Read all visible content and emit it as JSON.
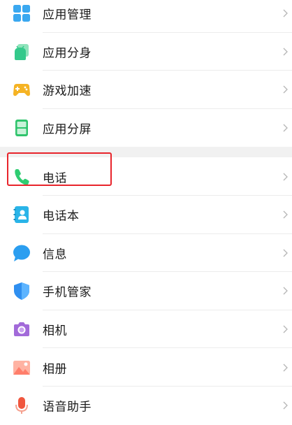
{
  "settings_group_1": {
    "items": [
      {
        "label": "应用管理",
        "icon": "app-management-icon",
        "color": "#3aa8f0"
      },
      {
        "label": "应用分身",
        "icon": "app-clone-icon",
        "color": "#34c98b"
      },
      {
        "label": "游戏加速",
        "icon": "game-acceleration-icon",
        "color": "#f5b324"
      },
      {
        "label": "应用分屏",
        "icon": "split-screen-icon",
        "color": "#2fc46c"
      }
    ]
  },
  "settings_group_2": {
    "items": [
      {
        "label": "电话",
        "icon": "phone-icon",
        "color": "#2ecc71"
      },
      {
        "label": "电话本",
        "icon": "contacts-icon",
        "color": "#2ab4e8"
      },
      {
        "label": "信息",
        "icon": "messages-icon",
        "color": "#2b9ef0"
      },
      {
        "label": "手机管家",
        "icon": "phone-manager-icon",
        "color": "#2f8ff0"
      },
      {
        "label": "相机",
        "icon": "camera-icon",
        "color": "#a26ad9"
      },
      {
        "label": "相册",
        "icon": "gallery-icon",
        "color": "#ff7e6b"
      },
      {
        "label": "语音助手",
        "icon": "voice-assistant-icon",
        "color": "#f0563e"
      }
    ]
  },
  "chevron_icon": "chevron-right-icon",
  "highlight_color": "#e8242b"
}
